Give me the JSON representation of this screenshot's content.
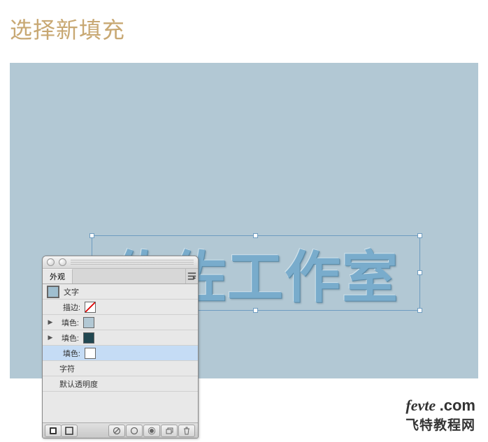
{
  "heading": "选择新填充",
  "canvas": {
    "text_object": "佐佐工作室"
  },
  "panel": {
    "tab": "外观",
    "rows": {
      "type_label": "文字",
      "stroke_label": "描边:",
      "fill1_label": "填色:",
      "fill2_label": "填色:",
      "fill3_label": "填色:",
      "char_label": "字符",
      "default_label": "默认透明度"
    }
  },
  "watermark": {
    "line1a": "fevte",
    "line1b": ".com",
    "line2": "飞特教程网"
  }
}
